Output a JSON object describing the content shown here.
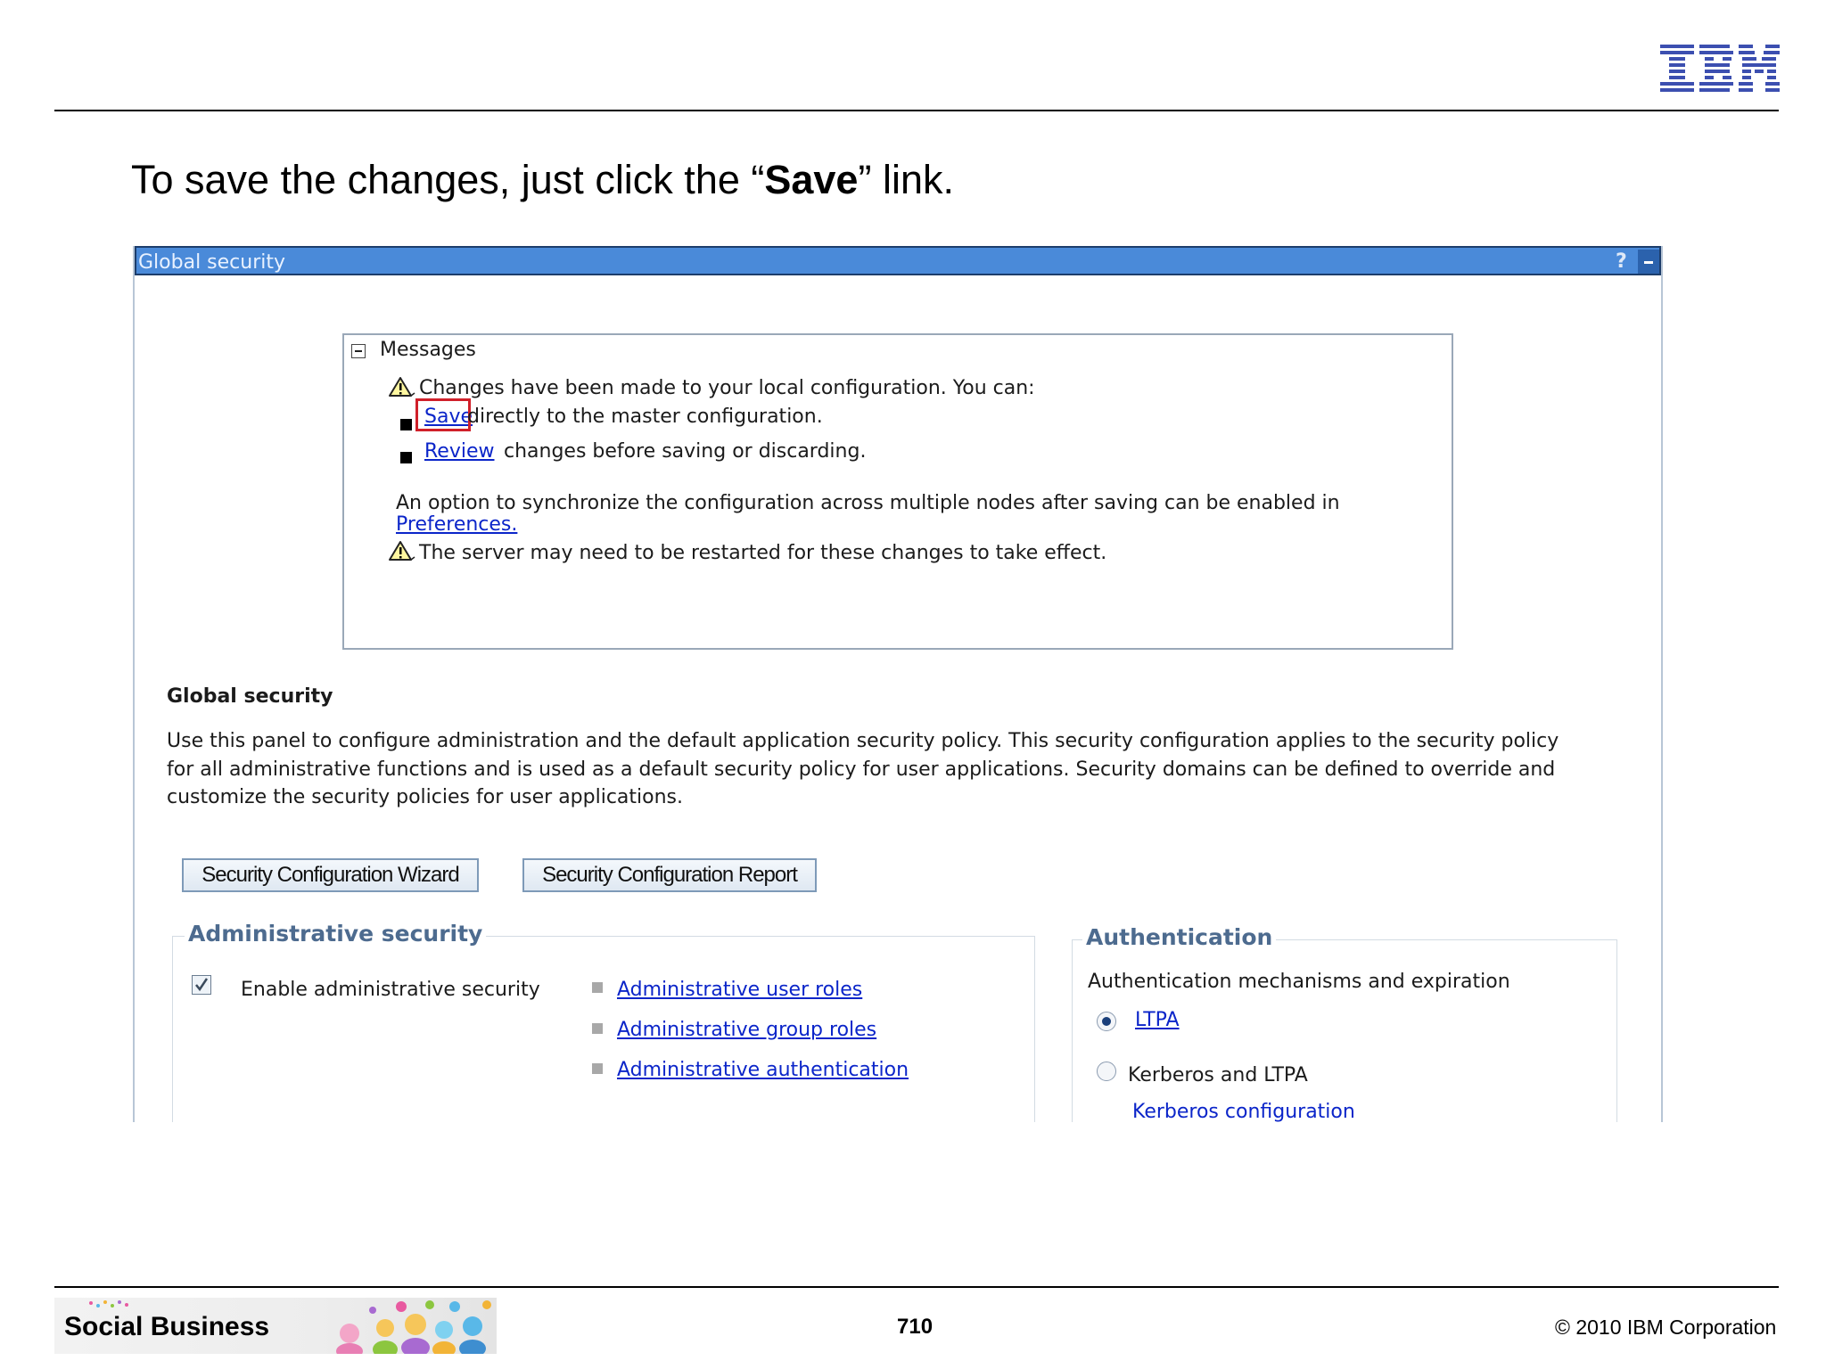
{
  "slide": {
    "logo_text": "IBM",
    "heading_before": "To save the changes, just click the “",
    "heading_bold": "Save",
    "heading_after": "” link.",
    "footer_brand": "Social Business",
    "page_number": "710",
    "copyright": "© 2010 IBM Corporation"
  },
  "panel": {
    "title": "Global security",
    "help_icon": "?",
    "minimize_icon": "minimize-icon"
  },
  "messages": {
    "header": "Messages",
    "warning_changes": "Changes have been made to your local configuration. You can:",
    "save_link": "Save",
    "save_rest": "directly to the master configuration.",
    "review_link": "Review",
    "review_rest": "changes before saving or discarding.",
    "sync_text": "An option to synchronize the configuration across multiple nodes after saving can be enabled in",
    "preferences_link": "Preferences.",
    "warning_restart": "The server may need to be restarted for these changes to take effect."
  },
  "global_security": {
    "title": "Global security",
    "description_line1": "Use this panel to configure administration and the default application security policy. This security configuration applies to the security policy",
    "description_line2": "for all administrative functions and is used as a default security policy for user applications. Security domains can be defined to override and",
    "description_line3": "customize the security policies for user applications.",
    "wizard_button": "Security Configuration Wizard",
    "report_button": "Security Configuration Report"
  },
  "admin_security": {
    "title": "Administrative security",
    "enable_label": "Enable administrative security",
    "enable_checked": true,
    "links": [
      "Administrative user roles",
      "Administrative group roles",
      "Administrative authentication"
    ]
  },
  "authentication": {
    "title": "Authentication",
    "subtitle": "Authentication mechanisms and expiration",
    "ltpa_label": "LTPA",
    "ltpa_selected": true,
    "kerberos_label": "Kerberos and LTPA",
    "kerberos_config_link": "Kerberos configuration"
  },
  "colors": {
    "titlebar": "#4a8ad9",
    "link": "#0b25c9",
    "section_heading": "#4d6b8f",
    "highlight": "#d0202a"
  }
}
